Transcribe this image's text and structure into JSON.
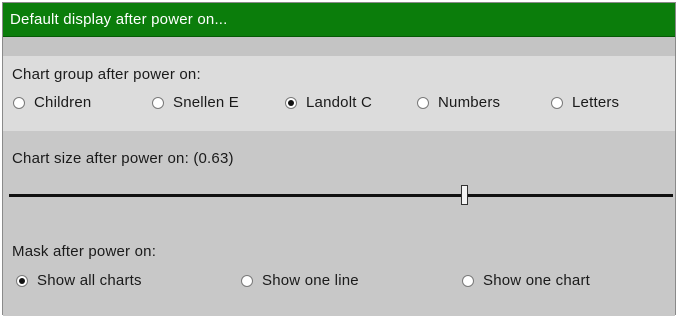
{
  "window": {
    "title": "Default display after power on..."
  },
  "chart_group": {
    "label": "Chart group after power on:",
    "selected": "Landolt C",
    "options": [
      {
        "label": "Children",
        "checked": false
      },
      {
        "label": "Snellen E",
        "checked": false
      },
      {
        "label": "Landolt C",
        "checked": true
      },
      {
        "label": "Numbers",
        "checked": false
      },
      {
        "label": "Letters",
        "checked": false
      }
    ]
  },
  "chart_size": {
    "label": "Chart size after power on: (0.63)",
    "value": 0.63,
    "slider_fraction": 0.685
  },
  "mask": {
    "label": "Mask after power on:",
    "selected": "Show all charts",
    "options": [
      {
        "label": "Show all charts",
        "checked": true
      },
      {
        "label": "Show one line",
        "checked": false
      },
      {
        "label": "Show one chart",
        "checked": false
      }
    ]
  }
}
